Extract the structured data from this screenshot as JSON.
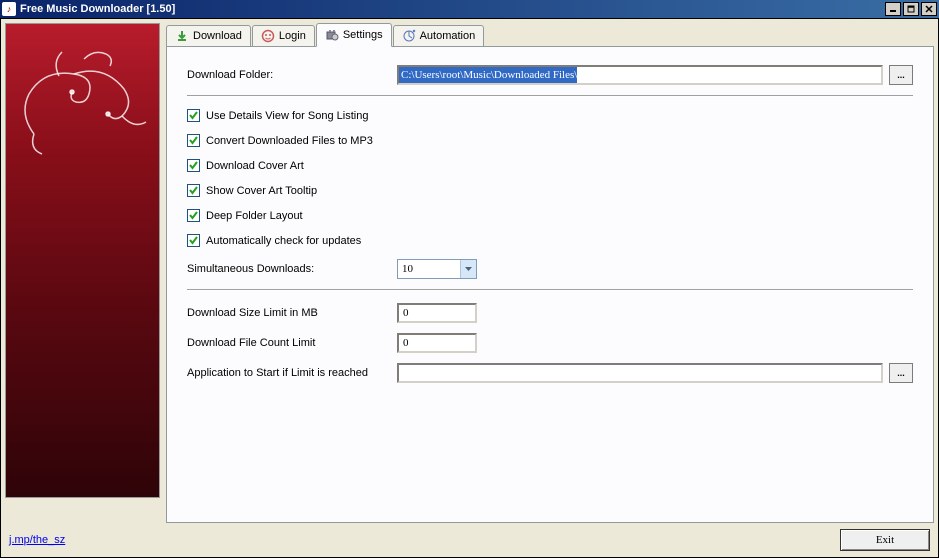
{
  "window": {
    "title": "Free Music Downloader [1.50]"
  },
  "tabs": {
    "download": "Download",
    "login": "Login",
    "settings": "Settings",
    "automation": "Automation"
  },
  "settings": {
    "folder_label": "Download Folder:",
    "folder_value": "C:\\Users\\root\\Music\\Downloaded Files\\",
    "browse_label": "...",
    "chk_details": "Use Details View for Song Listing",
    "chk_convert": "Convert Downloaded Files to MP3",
    "chk_cover": "Download Cover Art",
    "chk_tooltip": "Show Cover Art Tooltip",
    "chk_deep": "Deep Folder Layout",
    "chk_updates": "Automatically check for updates",
    "sim_label": "Simultaneous Downloads:",
    "sim_value": "10",
    "size_limit_label": "Download Size Limit in MB",
    "size_limit_value": "0",
    "count_limit_label": "Download File Count Limit",
    "count_limit_value": "0",
    "app_label": "Application to Start if Limit is reached",
    "app_value": "",
    "app_browse": "..."
  },
  "footer": {
    "link": "j.mp/the_sz",
    "exit": "Exit"
  }
}
